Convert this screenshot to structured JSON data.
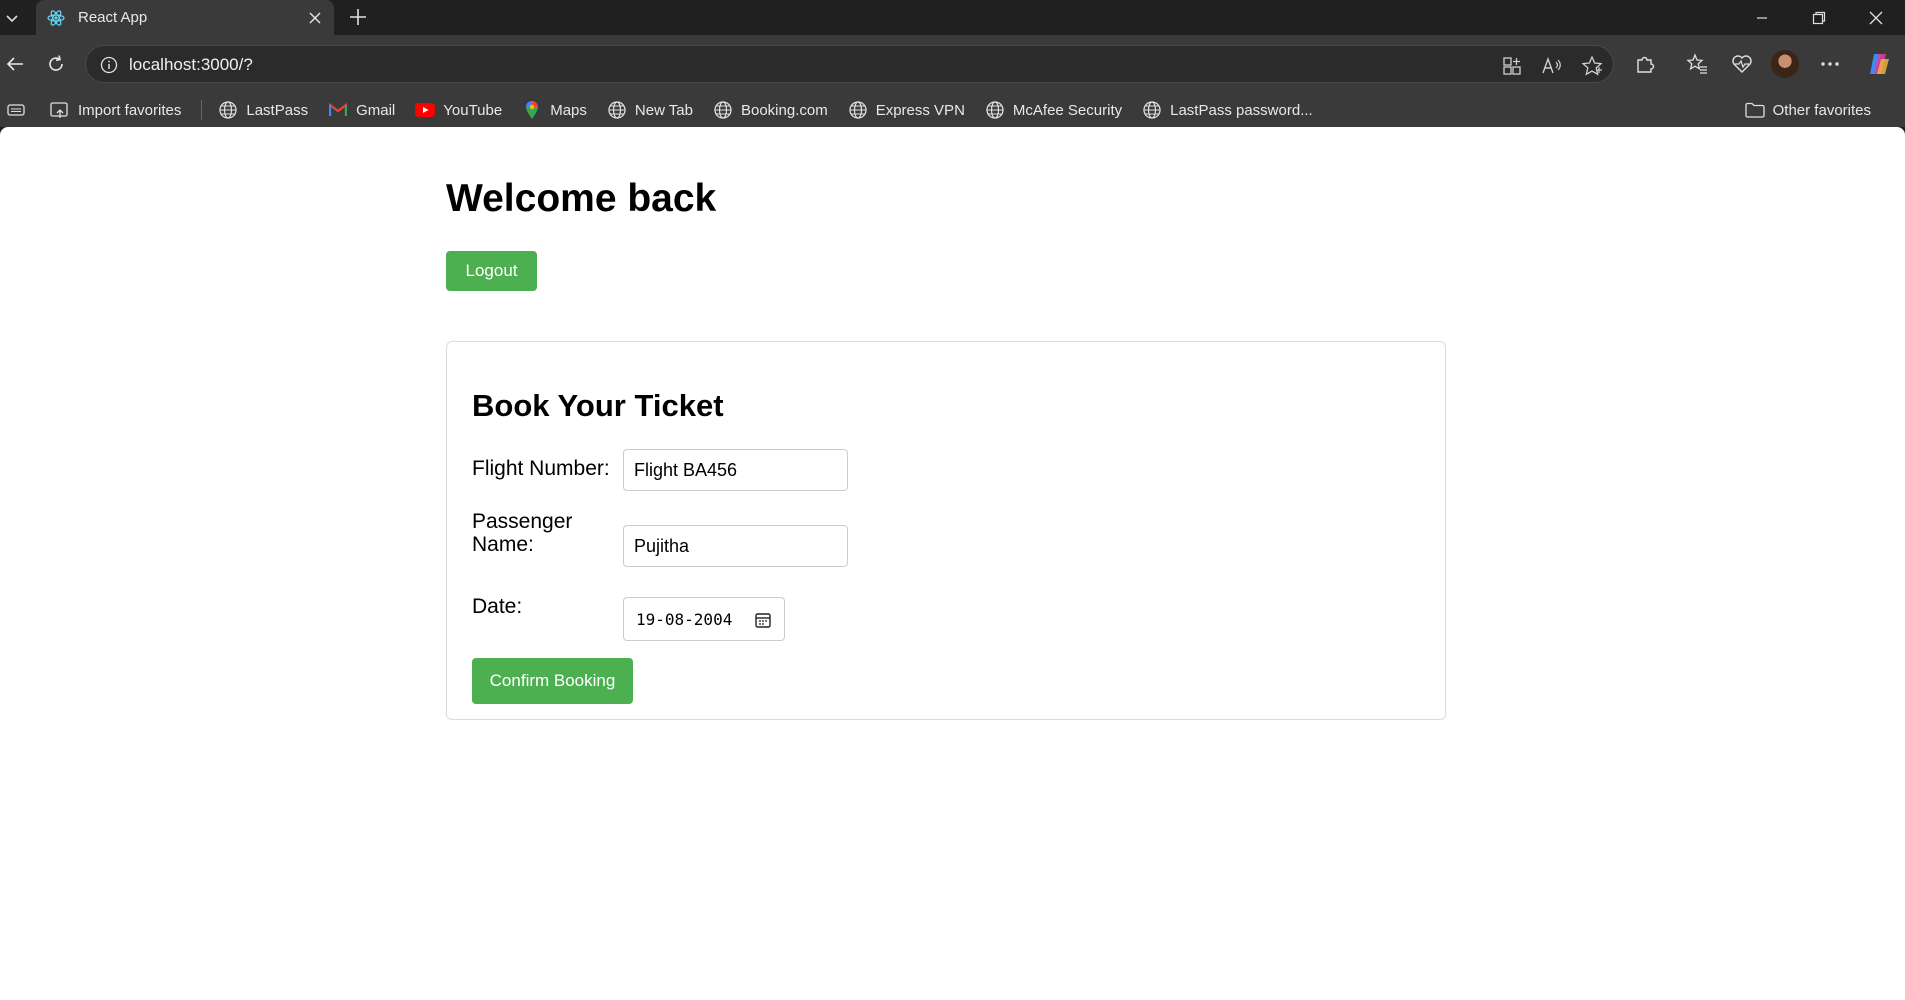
{
  "browser": {
    "tab_title": "React App",
    "url": "localhost:3000/?",
    "bookmarks": [
      {
        "label": "Import favorites",
        "icon": "import-icon"
      },
      {
        "label": "LastPass",
        "icon": "globe-icon"
      },
      {
        "label": "Gmail",
        "icon": "gmail-icon"
      },
      {
        "label": "YouTube",
        "icon": "youtube-icon"
      },
      {
        "label": "Maps",
        "icon": "maps-icon"
      },
      {
        "label": "New Tab",
        "icon": "globe-icon"
      },
      {
        "label": "Booking.com",
        "icon": "globe-icon"
      },
      {
        "label": "Express VPN",
        "icon": "globe-icon"
      },
      {
        "label": "McAfee Security",
        "icon": "globe-icon"
      },
      {
        "label": "LastPass password...",
        "icon": "globe-icon"
      }
    ],
    "other_favorites": "Other favorites"
  },
  "page": {
    "heading": "Welcome back",
    "logout_label": "Logout",
    "form": {
      "title": "Book Your Ticket",
      "flight_number_label": "Flight Number:",
      "flight_number_value": "Flight BA456",
      "passenger_label_line1": "Passenger",
      "passenger_label_line2": "Name:",
      "passenger_value": "Pujitha",
      "date_label": "Date:",
      "date_value": "19-08-2004",
      "confirm_label": "Confirm Booking"
    }
  },
  "colors": {
    "accent_green": "#4caf50",
    "chrome_dark": "#202020",
    "toolbar": "#3a3a3a"
  }
}
